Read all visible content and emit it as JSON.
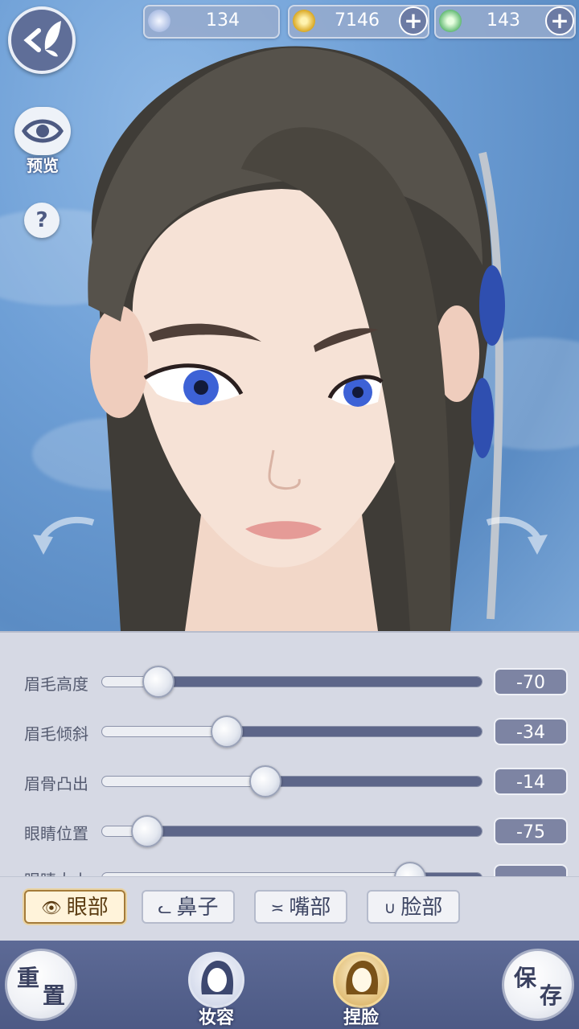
{
  "currencies": [
    {
      "name": "silver-coin",
      "value": "134",
      "has_plus": false
    },
    {
      "name": "gold-coin",
      "value": "7146",
      "has_plus": true
    },
    {
      "name": "jade-token",
      "value": "143",
      "has_plus": true
    }
  ],
  "preview_label": "预览",
  "help_label": "?",
  "sliders": [
    {
      "label": "眉毛高度",
      "value": "-70",
      "level": 0.15
    },
    {
      "label": "眉毛倾斜",
      "value": "-34",
      "level": 0.33
    },
    {
      "label": "眉骨凸出",
      "value": "-14",
      "level": 0.43
    },
    {
      "label": "眼睛位置",
      "value": "-75",
      "level": 0.12
    },
    {
      "label": "眼睛大小",
      "value": "",
      "level": 0.81
    }
  ],
  "tabs": [
    {
      "label": "眼部",
      "icon": "eye-icon",
      "active": true
    },
    {
      "label": "鼻子",
      "icon": "nose-icon",
      "active": false
    },
    {
      "label": "嘴部",
      "icon": "mouth-icon",
      "active": false
    },
    {
      "label": "脸部",
      "icon": "face-icon",
      "active": false
    }
  ],
  "bottom": {
    "reset": {
      "line1": "重",
      "line2": "置"
    },
    "makeup_label": "妆容",
    "face_label": "捏脸",
    "save": {
      "line1": "保",
      "line2": "存"
    }
  },
  "colors": {
    "panel": "#d6d9e4",
    "track_fill": "#5d6689",
    "value_box": "#7d84a3",
    "bottom_bar": "#4d5a85",
    "active_tab_border": "#a47b3a"
  }
}
